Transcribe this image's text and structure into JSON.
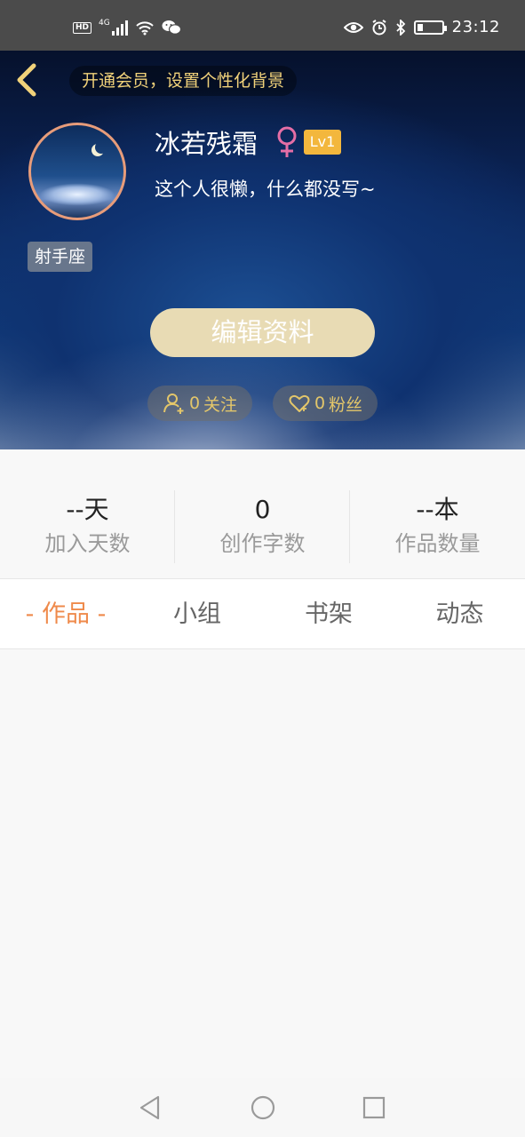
{
  "status_bar": {
    "hd": "HD",
    "network": "4G",
    "time": "23:12",
    "battery_level": 0.25
  },
  "header": {
    "vip_banner": "开通会员，设置个性化背景",
    "username": "冰若残霜",
    "level": "Lv1",
    "bio": "这个人很懒，什么都没写~",
    "zodiac": "射手座",
    "edit_button": "编辑资料",
    "follow": {
      "count": "0",
      "label": "关注"
    },
    "fans": {
      "count": "0",
      "label": "粉丝"
    }
  },
  "stats": [
    {
      "value": "--天",
      "label": "加入天数"
    },
    {
      "value": "0",
      "label": "创作字数"
    },
    {
      "value": "--本",
      "label": "作品数量"
    }
  ],
  "tabs": [
    {
      "label": "- 作品 -",
      "active": true
    },
    {
      "label": "小组",
      "active": false
    },
    {
      "label": "书架",
      "active": false
    },
    {
      "label": "动态",
      "active": false
    }
  ],
  "colors": {
    "accent": "#ef8a4b",
    "gold": "#f1d27a",
    "level_badge": "#f3b73d",
    "gender": "#e56ea6"
  },
  "icons": {
    "back": "chevron-left-icon",
    "gender": "female-icon",
    "follow": "add-user-icon",
    "fans": "heart-icon"
  }
}
